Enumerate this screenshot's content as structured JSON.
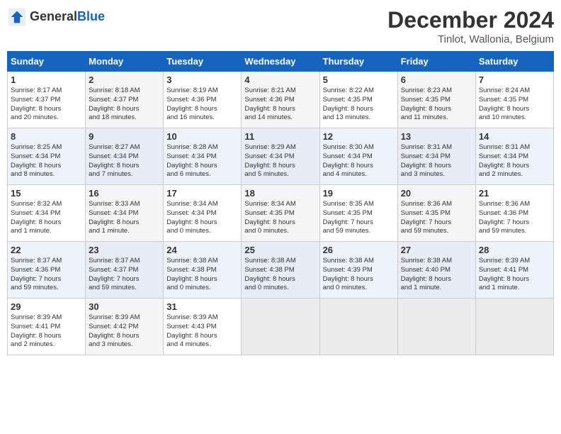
{
  "header": {
    "logo_general": "General",
    "logo_blue": "Blue",
    "month_year": "December 2024",
    "location": "Tinlot, Wallonia, Belgium"
  },
  "days_of_week": [
    "Sunday",
    "Monday",
    "Tuesday",
    "Wednesday",
    "Thursday",
    "Friday",
    "Saturday"
  ],
  "weeks": [
    [
      {
        "day": "1",
        "info": "Sunrise: 8:17 AM\nSunset: 4:37 PM\nDaylight: 8 hours\nand 20 minutes."
      },
      {
        "day": "2",
        "info": "Sunrise: 8:18 AM\nSunset: 4:37 PM\nDaylight: 8 hours\nand 18 minutes."
      },
      {
        "day": "3",
        "info": "Sunrise: 8:19 AM\nSunset: 4:36 PM\nDaylight: 8 hours\nand 16 minutes."
      },
      {
        "day": "4",
        "info": "Sunrise: 8:21 AM\nSunset: 4:36 PM\nDaylight: 8 hours\nand 14 minutes."
      },
      {
        "day": "5",
        "info": "Sunrise: 8:22 AM\nSunset: 4:35 PM\nDaylight: 8 hours\nand 13 minutes."
      },
      {
        "day": "6",
        "info": "Sunrise: 8:23 AM\nSunset: 4:35 PM\nDaylight: 8 hours\nand 11 minutes."
      },
      {
        "day": "7",
        "info": "Sunrise: 8:24 AM\nSunset: 4:35 PM\nDaylight: 8 hours\nand 10 minutes."
      }
    ],
    [
      {
        "day": "8",
        "info": "Sunrise: 8:25 AM\nSunset: 4:34 PM\nDaylight: 8 hours\nand 8 minutes."
      },
      {
        "day": "9",
        "info": "Sunrise: 8:27 AM\nSunset: 4:34 PM\nDaylight: 8 hours\nand 7 minutes."
      },
      {
        "day": "10",
        "info": "Sunrise: 8:28 AM\nSunset: 4:34 PM\nDaylight: 8 hours\nand 6 minutes."
      },
      {
        "day": "11",
        "info": "Sunrise: 8:29 AM\nSunset: 4:34 PM\nDaylight: 8 hours\nand 5 minutes."
      },
      {
        "day": "12",
        "info": "Sunrise: 8:30 AM\nSunset: 4:34 PM\nDaylight: 8 hours\nand 4 minutes."
      },
      {
        "day": "13",
        "info": "Sunrise: 8:31 AM\nSunset: 4:34 PM\nDaylight: 8 hours\nand 3 minutes."
      },
      {
        "day": "14",
        "info": "Sunrise: 8:31 AM\nSunset: 4:34 PM\nDaylight: 8 hours\nand 2 minutes."
      }
    ],
    [
      {
        "day": "15",
        "info": "Sunrise: 8:32 AM\nSunset: 4:34 PM\nDaylight: 8 hours\nand 1 minute."
      },
      {
        "day": "16",
        "info": "Sunrise: 8:33 AM\nSunset: 4:34 PM\nDaylight: 8 hours\nand 1 minute."
      },
      {
        "day": "17",
        "info": "Sunrise: 8:34 AM\nSunset: 4:34 PM\nDaylight: 8 hours\nand 0 minutes."
      },
      {
        "day": "18",
        "info": "Sunrise: 8:34 AM\nSunset: 4:35 PM\nDaylight: 8 hours\nand 0 minutes."
      },
      {
        "day": "19",
        "info": "Sunrise: 8:35 AM\nSunset: 4:35 PM\nDaylight: 7 hours\nand 59 minutes."
      },
      {
        "day": "20",
        "info": "Sunrise: 8:36 AM\nSunset: 4:35 PM\nDaylight: 7 hours\nand 59 minutes."
      },
      {
        "day": "21",
        "info": "Sunrise: 8:36 AM\nSunset: 4:36 PM\nDaylight: 7 hours\nand 59 minutes."
      }
    ],
    [
      {
        "day": "22",
        "info": "Sunrise: 8:37 AM\nSunset: 4:36 PM\nDaylight: 7 hours\nand 59 minutes."
      },
      {
        "day": "23",
        "info": "Sunrise: 8:37 AM\nSunset: 4:37 PM\nDaylight: 7 hours\nand 59 minutes."
      },
      {
        "day": "24",
        "info": "Sunrise: 8:38 AM\nSunset: 4:38 PM\nDaylight: 8 hours\nand 0 minutes."
      },
      {
        "day": "25",
        "info": "Sunrise: 8:38 AM\nSunset: 4:38 PM\nDaylight: 8 hours\nand 0 minutes."
      },
      {
        "day": "26",
        "info": "Sunrise: 8:38 AM\nSunset: 4:39 PM\nDaylight: 8 hours\nand 0 minutes."
      },
      {
        "day": "27",
        "info": "Sunrise: 8:38 AM\nSunset: 4:40 PM\nDaylight: 8 hours\nand 1 minute."
      },
      {
        "day": "28",
        "info": "Sunrise: 8:39 AM\nSunset: 4:41 PM\nDaylight: 8 hours\nand 1 minute."
      }
    ],
    [
      {
        "day": "29",
        "info": "Sunrise: 8:39 AM\nSunset: 4:41 PM\nDaylight: 8 hours\nand 2 minutes."
      },
      {
        "day": "30",
        "info": "Sunrise: 8:39 AM\nSunset: 4:42 PM\nDaylight: 8 hours\nand 3 minutes."
      },
      {
        "day": "31",
        "info": "Sunrise: 8:39 AM\nSunset: 4:43 PM\nDaylight: 8 hours\nand 4 minutes."
      },
      {
        "day": "",
        "info": ""
      },
      {
        "day": "",
        "info": ""
      },
      {
        "day": "",
        "info": ""
      },
      {
        "day": "",
        "info": ""
      }
    ]
  ]
}
